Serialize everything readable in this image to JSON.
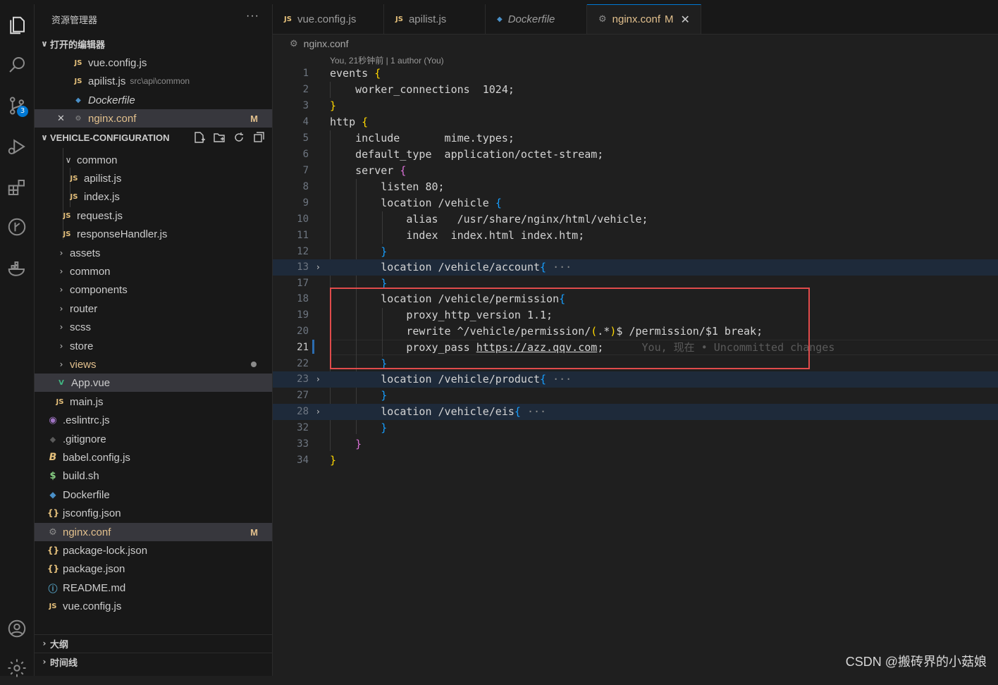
{
  "explorer": {
    "title": "资源管理器",
    "more": "···",
    "open_editors_title": "打开的编辑器",
    "open_editors": [
      {
        "icon": "JS",
        "name": "vue.config.js",
        "path": ""
      },
      {
        "icon": "JS",
        "name": "apilist.js",
        "path": "src\\api\\common"
      },
      {
        "icon": "docker",
        "name": "Dockerfile",
        "path": ""
      },
      {
        "icon": "gear",
        "name": "nginx.conf",
        "path": "",
        "status": "M",
        "close": "✕"
      }
    ],
    "project_title": "VEHICLE-CONFIGURATION",
    "tree": [
      {
        "name": "common",
        "chev": "∨"
      },
      {
        "icon": "JS",
        "name": "apilist.js"
      },
      {
        "icon": "JS",
        "name": "index.js"
      },
      {
        "icon": "JS",
        "name": "request.js"
      },
      {
        "icon": "JS",
        "name": "responseHandler.js"
      },
      {
        "name": "assets",
        "chev": "›"
      },
      {
        "name": "common",
        "chev": "›"
      },
      {
        "name": "components",
        "chev": "›"
      },
      {
        "name": "router",
        "chev": "›"
      },
      {
        "name": "scss",
        "chev": "›"
      },
      {
        "name": "store",
        "chev": "›"
      },
      {
        "name": "views",
        "chev": "›"
      },
      {
        "icon": "V",
        "name": "App.vue"
      },
      {
        "icon": "JS",
        "name": "main.js"
      },
      {
        "icon": "◉",
        "name": ".eslintrc.js"
      },
      {
        "icon": "◆",
        "name": ".gitignore"
      },
      {
        "icon": "B",
        "name": "babel.config.js"
      },
      {
        "icon": "$",
        "name": "build.sh"
      },
      {
        "icon": "docker",
        "name": "Dockerfile"
      },
      {
        "icon": "{}",
        "name": "jsconfig.json"
      },
      {
        "icon": "gear",
        "name": "nginx.conf",
        "status": "M"
      },
      {
        "icon": "{}",
        "name": "package-lock.json"
      },
      {
        "icon": "ⓘ",
        "name": "README.md"
      },
      {
        "icon": "{}",
        "name": "package.json"
      },
      {
        "icon": "JS",
        "name": "vue.config.js"
      }
    ],
    "outline_title": "大纲",
    "timeline_title": "时间线"
  },
  "tabs": [
    {
      "icon": "JS",
      "label": "vue.config.js"
    },
    {
      "icon": "docker",
      "label": "apilist.js"
    },
    {
      "icon": "docker",
      "label": "Dockerfile"
    },
    {
      "icon": "gear",
      "label": "nginx.conf",
      "status": "M",
      "close": "✕"
    }
  ],
  "editor": {
    "breadcrumb": "nginx.conf",
    "codelens": "You, 21秒钟前 | 1 author (You)",
    "inline_blame": "You, 现在 • Uncommitted changes",
    "lines": [
      {
        "n": "1",
        "t": "events {"
      },
      {
        "n": "2",
        "t": "    worker_connections  1024;"
      },
      {
        "n": "3",
        "t": "}"
      },
      {
        "n": "4",
        "t": "http {"
      },
      {
        "n": "5",
        "t": "    include       mime.types;"
      },
      {
        "n": "6",
        "t": "    default_type  application/octet-stream;"
      },
      {
        "n": "7",
        "t": "    server {"
      },
      {
        "n": "8",
        "t": "        listen 80;"
      },
      {
        "n": "9",
        "t": "        location /vehicle {"
      },
      {
        "n": "10",
        "t": "            alias   /usr/share/nginx/html/vehicle;"
      },
      {
        "n": "11",
        "t": "            index  index.html index.htm;"
      },
      {
        "n": "12",
        "t": "        }"
      },
      {
        "n": "13",
        "t": "        location /vehicle/account{ ···"
      },
      {
        "n": "17",
        "t": "        }"
      },
      {
        "n": "18",
        "t": "        location /vehicle/permission{"
      },
      {
        "n": "19",
        "t": "            proxy_http_version 1.1;"
      },
      {
        "n": "20",
        "t": "            rewrite ^/vehicle/permission/(.*)$ /permission/$1 break;"
      },
      {
        "n": "21",
        "t": "            proxy_pass https://azz.qqv.com;"
      },
      {
        "n": "22",
        "t": "        }"
      },
      {
        "n": "23",
        "t": "        location /vehicle/product{ ···"
      },
      {
        "n": "27",
        "t": "        }"
      },
      {
        "n": "28",
        "t": "        location /vehicle/eis{ ···"
      },
      {
        "n": "32",
        "t": "        }"
      },
      {
        "n": "33",
        "t": "    }"
      },
      {
        "n": "34",
        "t": "}"
      }
    ]
  },
  "scm_badge": "3",
  "watermark": "CSDN @搬砖界的小菇娘",
  "colors": {
    "accent": "#0078d4",
    "modified": "#e2c08d",
    "highlight_box": "#e04b4b"
  }
}
